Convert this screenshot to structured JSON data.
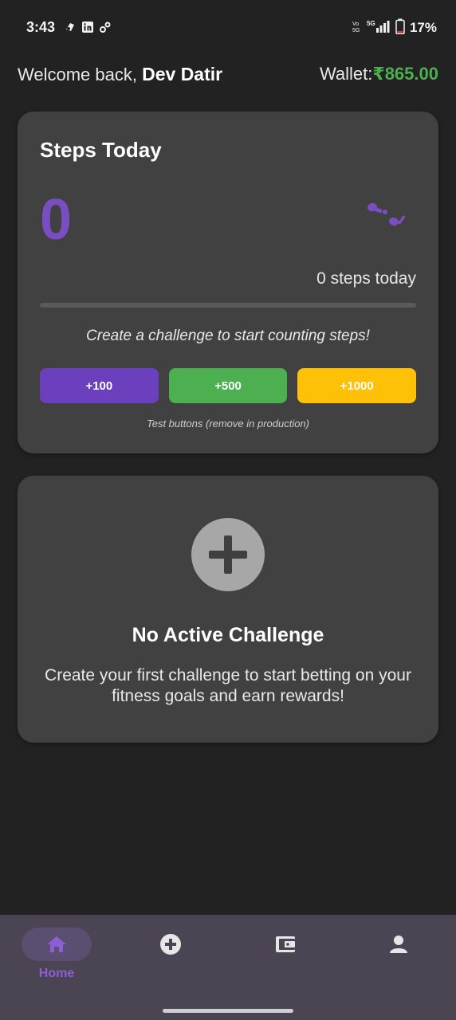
{
  "status_bar": {
    "time": "3:43",
    "network": "5G",
    "battery_percent": "17%",
    "battery_level": 0.17
  },
  "header": {
    "welcome_prefix": "Welcome back,",
    "user_name": "Dev Datir",
    "wallet_label": "Wallet:",
    "wallet_amount": "₹865.00"
  },
  "steps_card": {
    "title": "Steps Today",
    "count": "0",
    "steps_label": "0 steps today",
    "progress": 0,
    "hint": "Create a challenge to start counting steps!",
    "buttons": [
      {
        "label": "+100",
        "color": "#6b3fbd"
      },
      {
        "label": "+500",
        "color": "#4caf50"
      },
      {
        "label": "+1000",
        "color": "#ffc107"
      }
    ],
    "test_note": "Test buttons (remove in production)"
  },
  "challenge_card": {
    "title": "No Active Challenge",
    "description": "Create your first challenge to start betting on your fitness goals and earn rewards!"
  },
  "bottom_nav": {
    "items": [
      {
        "icon": "home-icon",
        "label": "Home",
        "active": true
      },
      {
        "icon": "add-circle-icon",
        "label": "",
        "active": false
      },
      {
        "icon": "wallet-icon",
        "label": "",
        "active": false
      },
      {
        "icon": "profile-icon",
        "label": "",
        "active": false
      }
    ]
  },
  "colors": {
    "background": "#222222",
    "card": "#414141",
    "accent_purple": "#7a4ec2",
    "wallet_green": "#4caf50",
    "nav_background": "#4a4453"
  }
}
